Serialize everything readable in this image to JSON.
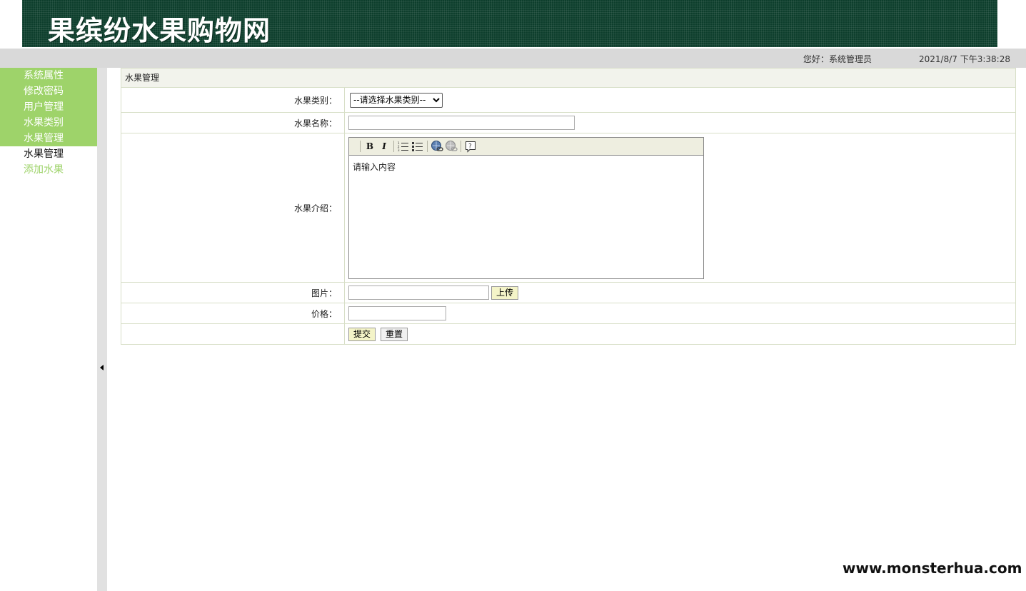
{
  "header": {
    "site_title": "果缤纷水果购物网"
  },
  "status": {
    "greeting": "您好：系统管理员",
    "datetime": "2021/8/7 下午3:38:28"
  },
  "sidebar": {
    "items": [
      {
        "label": "系统属性"
      },
      {
        "label": "修改密码"
      },
      {
        "label": "用户管理"
      },
      {
        "label": "水果类别"
      },
      {
        "label": "水果管理"
      },
      {
        "label": "水果管理"
      },
      {
        "label": "添加水果"
      }
    ]
  },
  "form": {
    "title": "水果管理",
    "category_label": "水果类别：",
    "category_selected": "--请选择水果类别--",
    "name_label": "水果名称：",
    "name_value": "",
    "intro_label": "水果介绍：",
    "intro_content": "请输入内容",
    "image_label": "图片：",
    "image_value": "",
    "upload_label": "上传",
    "price_label": "价格：",
    "price_value": "",
    "submit_label": "提交",
    "reset_label": "重置"
  },
  "editor_toolbar": {
    "bold": "B",
    "italic": "I",
    "icons": [
      "bold-icon",
      "italic-icon",
      "ordered-list-icon",
      "unordered-list-icon",
      "insert-link-icon",
      "remove-link-icon",
      "help-icon"
    ]
  },
  "watermark": "www.monsterhua.com"
}
